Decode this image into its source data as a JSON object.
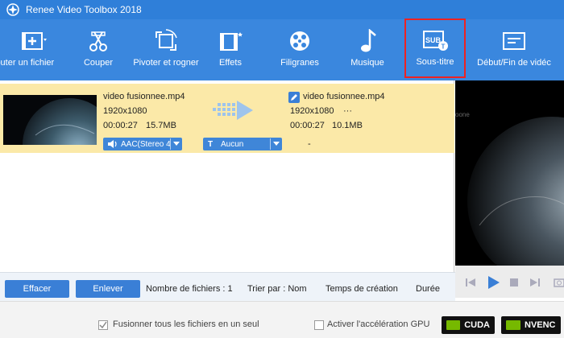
{
  "window": {
    "title": "Renee Video Toolbox 2018"
  },
  "toolbar": {
    "items": [
      {
        "label": "jouter un fichier",
        "icon": "add-file-icon"
      },
      {
        "label": "Couper",
        "icon": "cut-icon"
      },
      {
        "label": "Pivoter et rogner",
        "icon": "crop-rotate-icon"
      },
      {
        "label": "Effets",
        "icon": "effects-icon"
      },
      {
        "label": "Filigranes",
        "icon": "watermark-icon"
      },
      {
        "label": "Musique",
        "icon": "music-icon"
      },
      {
        "label": "Sous-titre",
        "icon": "subtitle-icon",
        "highlighted": true
      },
      {
        "label": "Début/Fin de vidéc",
        "icon": "intro-outro-icon"
      }
    ]
  },
  "file": {
    "source": {
      "name": "video fusionnee.mp4",
      "resolution": "1920x1080",
      "duration": "00:00:27",
      "size": "15.7MB"
    },
    "output": {
      "name": "video fusionnee.mp4",
      "resolution": "1920x1080",
      "extra": "···",
      "duration": "00:00:27",
      "size": "10.1MB"
    },
    "audio_track": "AAC(Stereo 4",
    "subtitle": "Aucun",
    "dash": "-"
  },
  "bottom": {
    "clear_label": "Effacer",
    "remove_label": "Enlever",
    "file_count": "Nombre de fichiers : 1",
    "sort_by": "Trier par : Nom",
    "creation_time": "Temps de création",
    "duration": "Durée"
  },
  "footer": {
    "merge_label": "Fusionner tous les fichiers en un seul",
    "gpu_label": "Activer l'accélération GPU",
    "cuda": "CUDA",
    "nvenc": "NVENC"
  },
  "colors": {
    "titlebar": "#2f7fd9",
    "toolbar": "#3a87de",
    "row": "#fbe9a8",
    "accent": "#3a7fd6",
    "highlight": "#e22222"
  }
}
